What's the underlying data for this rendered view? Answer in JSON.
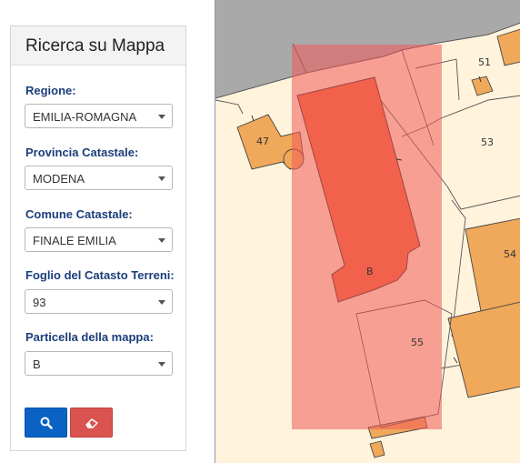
{
  "panel": {
    "title": "Ricerca su Mappa",
    "fields": [
      {
        "label": "Regione:",
        "value": "EMILIA-ROMAGNA"
      },
      {
        "label": "Provincia Catastale:",
        "value": "MODENA"
      },
      {
        "label": "Comune Catastale:",
        "value": "FINALE EMILIA"
      },
      {
        "label": "Foglio del Catasto Terreni:",
        "value": "93"
      },
      {
        "label": "Particella della mappa:",
        "value": "B"
      }
    ],
    "buttons": {
      "search_icon": "search-icon",
      "clear_icon": "eraser-icon"
    }
  },
  "map": {
    "parcel_labels": [
      "51",
      "47",
      "53",
      "54",
      "B",
      "55"
    ]
  },
  "colors": {
    "label_blue": "#1b3e7a",
    "search_button": "#0a62c4",
    "clear_button": "#d9534f",
    "land": "#fff3dc",
    "building": "#f0a85a",
    "selected_parcel": "#f26a3a",
    "highlight": "#f26060",
    "road": "#a9a9a9"
  }
}
